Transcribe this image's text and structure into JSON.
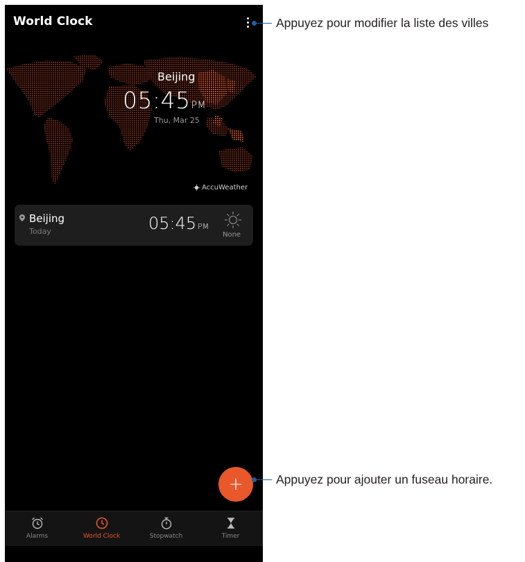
{
  "app": {
    "title": "World Clock"
  },
  "hero": {
    "city": "Beijing",
    "time": "05:45",
    "ampm": "PM",
    "date": "Thu, Mar 25"
  },
  "provider": {
    "label": "AccuWeather"
  },
  "cities": [
    {
      "name": "Beijing",
      "day": "Today",
      "time": "05:45",
      "ampm": "PM",
      "weather": "None"
    }
  ],
  "fab": {
    "symbol": "+"
  },
  "nav": {
    "items": [
      {
        "label": "Alarms",
        "icon": "alarm-icon"
      },
      {
        "label": "World Clock",
        "icon": "clock-icon",
        "active": true
      },
      {
        "label": "Stopwatch",
        "icon": "stopwatch-icon"
      },
      {
        "label": "Timer",
        "icon": "hourglass-icon"
      }
    ]
  },
  "callouts": {
    "menu": "Appuyez pour modifier la liste des villes",
    "add": "Appuyez pour ajouter un fuseau horaire."
  },
  "colors": {
    "accent": "#e8582b",
    "callout_line": "#1e5fa3",
    "map_dots": "#7a2e1a",
    "card_bg": "#1e1e1e"
  }
}
